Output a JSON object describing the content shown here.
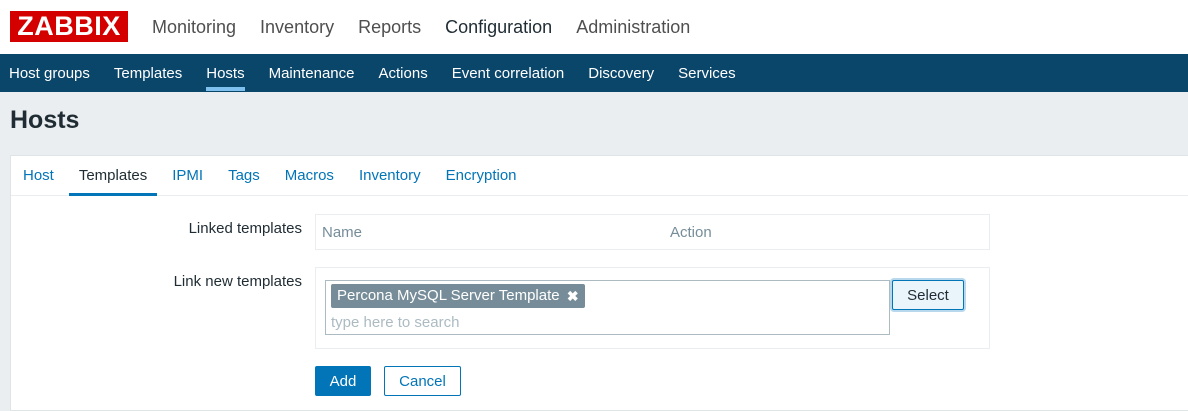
{
  "logo": "ZABBIX",
  "top_nav": [
    "Monitoring",
    "Inventory",
    "Reports",
    "Configuration",
    "Administration"
  ],
  "sub_nav": [
    "Host groups",
    "Templates",
    "Hosts",
    "Maintenance",
    "Actions",
    "Event correlation",
    "Discovery",
    "Services"
  ],
  "page_title": "Hosts",
  "tabs": [
    "Host",
    "Templates",
    "IPMI",
    "Tags",
    "Macros",
    "Inventory",
    "Encryption"
  ],
  "form": {
    "linked_templates_label": "Linked templates",
    "linked_col_name": "Name",
    "linked_col_action": "Action",
    "link_new_label": "Link new templates",
    "chip_label": "Percona MySQL Server Template",
    "chip_remove": "✖",
    "search_placeholder": "type here to search",
    "select_button": "Select",
    "add_button": "Add",
    "cancel_button": "Cancel"
  },
  "colors": {
    "brand": "#d40000",
    "nav_bg": "#0a466a",
    "accent": "#0275b8"
  }
}
